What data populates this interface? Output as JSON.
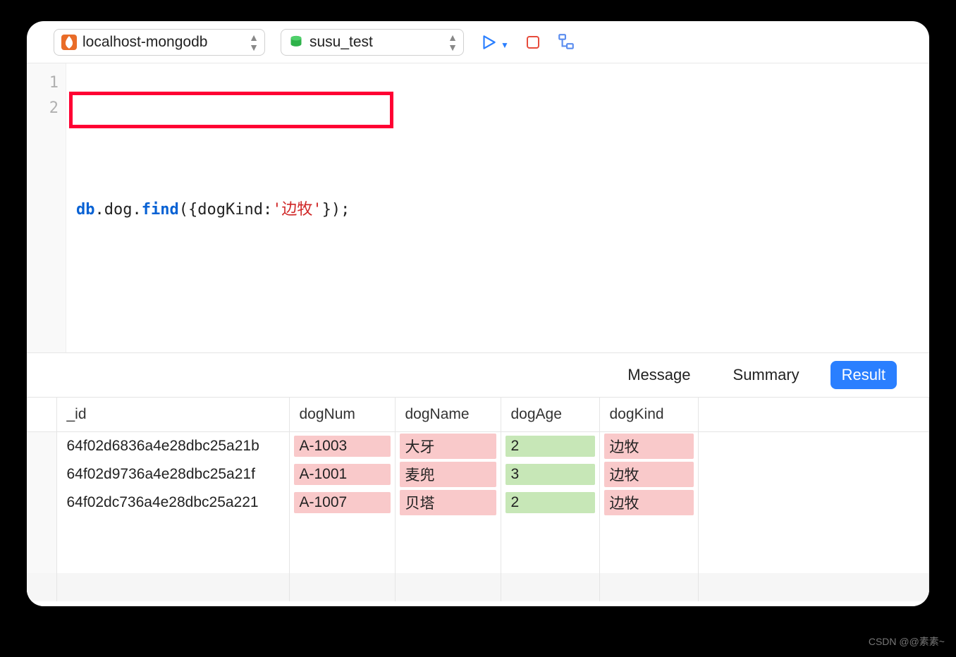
{
  "toolbar": {
    "connection": "localhost-mongodb",
    "database": "susu_test"
  },
  "editor": {
    "lines": [
      "",
      "db.dog.find({dogKind:'边牧'});"
    ],
    "tokens_line2": {
      "db": "db",
      "dot1": ".",
      "dog": "dog",
      "dot2": ".",
      "find": "find",
      "open": "({dogKind:",
      "str": "'边牧'",
      "close": "});"
    }
  },
  "tabs": {
    "message": "Message",
    "summary": "Summary",
    "result": "Result"
  },
  "table": {
    "headers": {
      "id": "_id",
      "dogNum": "dogNum",
      "dogName": "dogName",
      "dogAge": "dogAge",
      "dogKind": "dogKind"
    },
    "rows": [
      {
        "id": "64f02d6836a4e28dbc25a21b",
        "dogNum": "A-1003",
        "dogName": "大牙",
        "dogAge": "2",
        "dogKind": "边牧"
      },
      {
        "id": "64f02d9736a4e28dbc25a21f",
        "dogNum": "A-1001",
        "dogName": "麦兜",
        "dogAge": "3",
        "dogKind": "边牧"
      },
      {
        "id": "64f02dc736a4e28dbc25a221",
        "dogNum": "A-1007",
        "dogName": "贝塔",
        "dogAge": "2",
        "dogKind": "边牧"
      }
    ]
  },
  "watermark": "CSDN @@素素~"
}
